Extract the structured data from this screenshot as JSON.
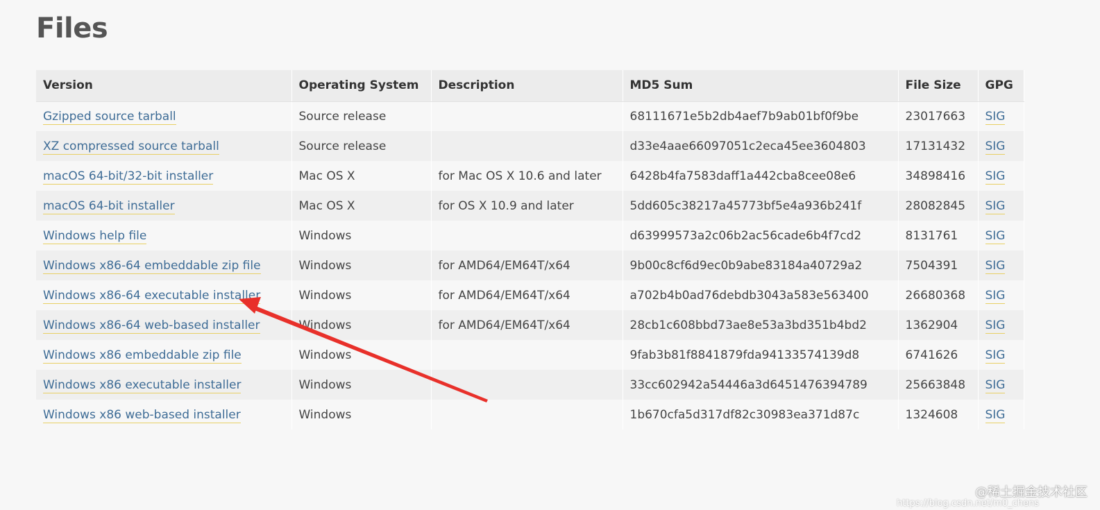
{
  "page": {
    "title": "Files"
  },
  "table": {
    "headers": {
      "version": "Version",
      "os": "Operating System",
      "description": "Description",
      "md5": "MD5 Sum",
      "size": "File Size",
      "gpg": "GPG"
    },
    "rows": [
      {
        "version": "Gzipped source tarball",
        "os": "Source release",
        "description": "",
        "md5": "68111671e5b2db4aef7b9ab01bf0f9be",
        "size": "23017663",
        "gpg": "SIG"
      },
      {
        "version": "XZ compressed source tarball",
        "os": "Source release",
        "description": "",
        "md5": "d33e4aae66097051c2eca45ee3604803",
        "size": "17131432",
        "gpg": "SIG"
      },
      {
        "version": "macOS 64-bit/32-bit installer",
        "os": "Mac OS X",
        "description": "for Mac OS X 10.6 and later",
        "md5": "6428b4fa7583daff1a442cba8cee08e6",
        "size": "34898416",
        "gpg": "SIG"
      },
      {
        "version": "macOS 64-bit installer",
        "os": "Mac OS X",
        "description": "for OS X 10.9 and later",
        "md5": "5dd605c38217a45773bf5e4a936b241f",
        "size": "28082845",
        "gpg": "SIG"
      },
      {
        "version": "Windows help file",
        "os": "Windows",
        "description": "",
        "md5": "d63999573a2c06b2ac56cade6b4f7cd2",
        "size": "8131761",
        "gpg": "SIG"
      },
      {
        "version": "Windows x86-64 embeddable zip file",
        "os": "Windows",
        "description": "for AMD64/EM64T/x64",
        "md5": "9b00c8cf6d9ec0b9abe83184a40729a2",
        "size": "7504391",
        "gpg": "SIG"
      },
      {
        "version": "Windows x86-64 executable installer",
        "os": "Windows",
        "description": "for AMD64/EM64T/x64",
        "md5": "a702b4b0ad76debdb3043a583e563400",
        "size": "26680368",
        "gpg": "SIG"
      },
      {
        "version": "Windows x86-64 web-based installer",
        "os": "Windows",
        "description": "for AMD64/EM64T/x64",
        "md5": "28cb1c608bbd73ae8e53a3bd351b4bd2",
        "size": "1362904",
        "gpg": "SIG"
      },
      {
        "version": "Windows x86 embeddable zip file",
        "os": "Windows",
        "description": "",
        "md5": "9fab3b81f8841879fda94133574139d8",
        "size": "6741626",
        "gpg": "SIG"
      },
      {
        "version": "Windows x86 executable installer",
        "os": "Windows",
        "description": "",
        "md5": "33cc602942a54446a3d6451476394789",
        "size": "25663848",
        "gpg": "SIG"
      },
      {
        "version": "Windows x86 web-based installer",
        "os": "Windows",
        "description": "",
        "md5": "1b670cfa5d317df82c30983ea371d87c",
        "size": "1324608",
        "gpg": "SIG"
      }
    ]
  },
  "annotation": {
    "arrow_color": "#e8302a",
    "points_to": "Windows x86-64 executable installer"
  },
  "watermark": {
    "text": "@稀土掘金技术社区",
    "url": "https://blog.csdn.net/m0_chens"
  },
  "colors": {
    "link": "#3e6c96",
    "link_underline": "#e8cf63",
    "header_bg": "#ececec",
    "row_odd": "#f7f7f7",
    "row_even": "#efefef",
    "page_bg": "#f7f7f7"
  }
}
